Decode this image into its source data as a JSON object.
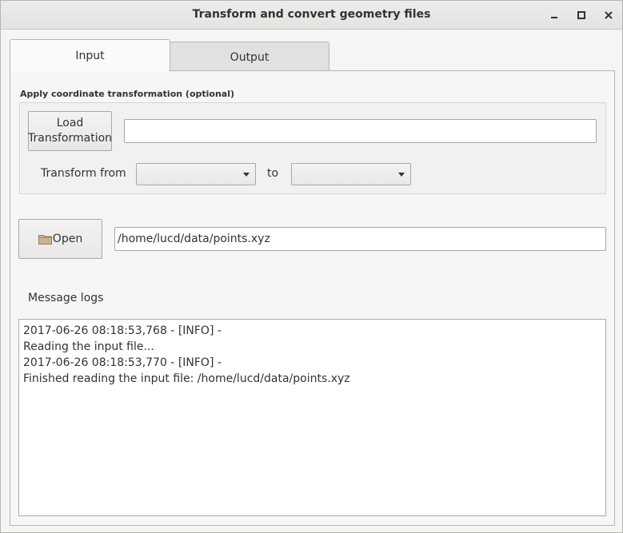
{
  "window": {
    "title": "Transform and convert geometry files",
    "controls": [
      "minimize-icon",
      "maximize-icon",
      "close-icon"
    ]
  },
  "tabs": [
    {
      "label": "Input",
      "active": true
    },
    {
      "label": "Output",
      "active": false
    }
  ],
  "transform_group": {
    "title": "Apply coordinate transformation (optional)",
    "load_button_line1": "Load",
    "load_button_line2": "Transformation",
    "transformation_path": "",
    "from_label": "Transform from",
    "from_value": "",
    "to_label": "to",
    "to_value": ""
  },
  "open": {
    "button_label": "Open",
    "file_path": "/home/lucd/data/points.xyz"
  },
  "logs": {
    "title": "Message logs",
    "lines": [
      "2017-06-26 08:18:53,768 - [INFO] -",
      "Reading the input file...",
      "2017-06-26 08:18:53,770 - [INFO] -",
      "Finished reading the input file: /home/lucd/data/points.xyz"
    ]
  },
  "colors": {
    "background": "#f6f5f4",
    "panel": "#f8f6f4",
    "border": "#b6b6b3",
    "text": "#2e3436",
    "folder": "#c9b48d"
  }
}
